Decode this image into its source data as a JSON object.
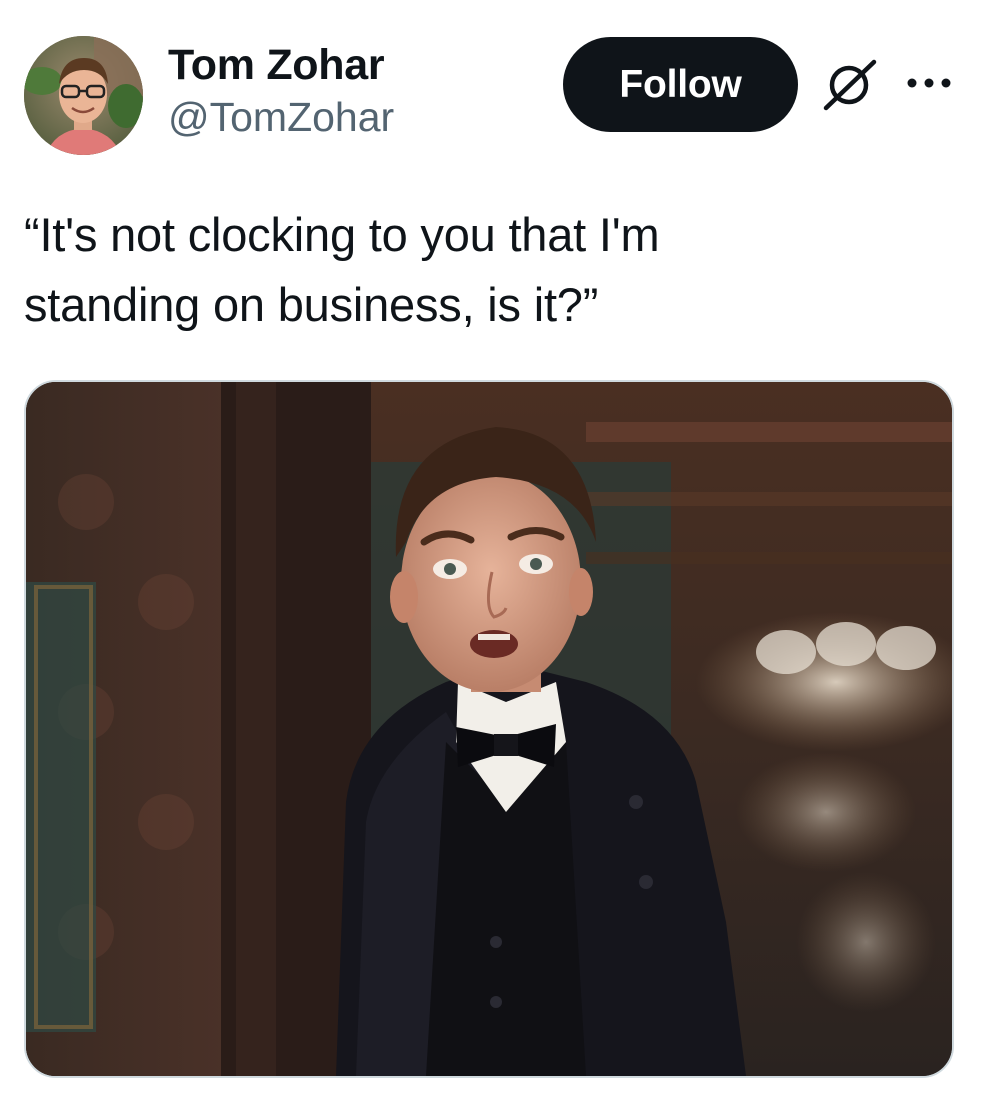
{
  "author": {
    "display_name": "Tom Zohar",
    "handle": "@TomZohar"
  },
  "actions": {
    "follow_label": "Follow",
    "grok_icon": "grok-icon",
    "more_icon": "more-options-icon"
  },
  "tweet": {
    "text": "“It's not clocking to you that I'm\nstanding on business, is it?”"
  },
  "media": {
    "type": "video-still",
    "description_icon": "photo-media"
  },
  "colors": {
    "text_primary": "#0f1419",
    "text_secondary": "#536471",
    "follow_button_bg": "#0f1419",
    "follow_button_text": "#ffffff",
    "border": "#cfd9de"
  }
}
